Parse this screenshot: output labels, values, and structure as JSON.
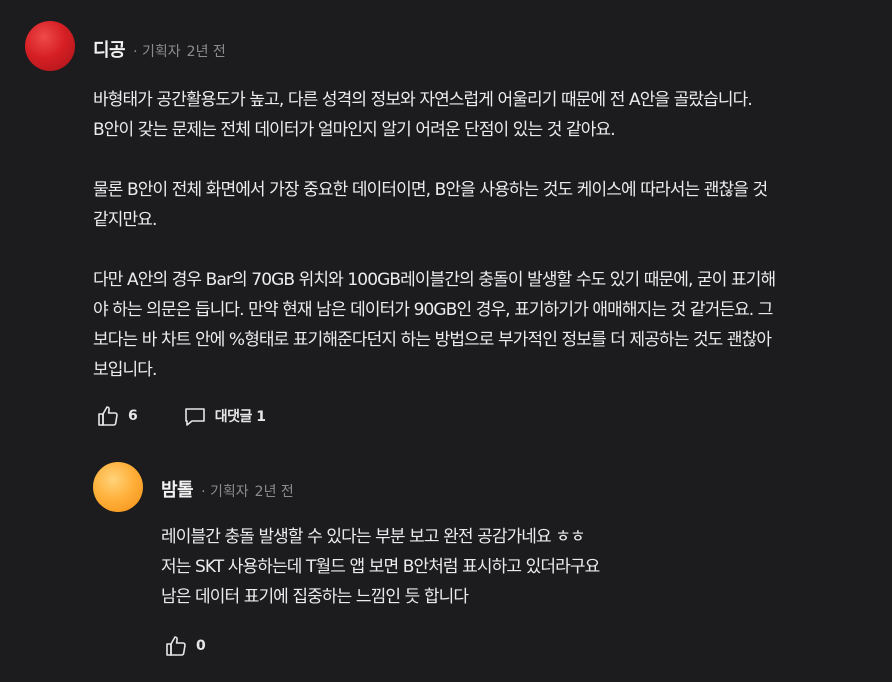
{
  "comments": [
    {
      "author": "디공",
      "role": "· 기획자",
      "time": "2년 전",
      "avatar_color": "#d61f24",
      "paragraphs": [
        [
          "바형태가 공간활용도가 높고, 다른 성격의 정보와 자연스럽게 어울리기 때문에 전 A안을 골랐습니다.",
          "B안이 갖는 문제는 전체 데이터가 얼마인지 알기 어려운 단점이 있는 것 같아요."
        ],
        [
          "물론 B안이 전체 화면에서 가장 중요한 데이터이면, B안을 사용하는 것도 케이스에 따라서는 괜찮을 것",
          "같지만요."
        ],
        [
          "다만 A안의 경우 Bar의 70GB 위치와 100GB레이블간의 충돌이 발생할 수도 있기 때문에, 굳이 표기해",
          "야 하는 의문은 듭니다. 만약 현재 남은 데이터가 90GB인 경우, 표기하기가 애매해지는 것 같거든요. 그",
          "보다는 바 차트 안에 %형태로 표기해준다던지 하는 방법으로 부가적인 정보를 더 제공하는 것도 괜찮아",
          "보입니다."
        ]
      ],
      "likes": "6",
      "reply_label": "대댓글 1",
      "like_icon": "thumbs-up-icon",
      "reply_icon": "chat-bubble-icon"
    },
    {
      "author": "밤톨",
      "role": "· 기획자",
      "time": "2년 전",
      "avatar_color": "#ffb13c",
      "paragraphs": [
        [
          "레이블간 충돌 발생할 수 있다는 부분 보고 완전 공감가네요 ㅎㅎ",
          "저는 SKT 사용하는데 T월드 앱 보면 B안처럼 표시하고 있더라구요",
          "남은 데이터 표기에 집중하는 느낌인 듯 합니다"
        ]
      ],
      "likes": "0",
      "like_icon": "thumbs-up-icon"
    }
  ]
}
